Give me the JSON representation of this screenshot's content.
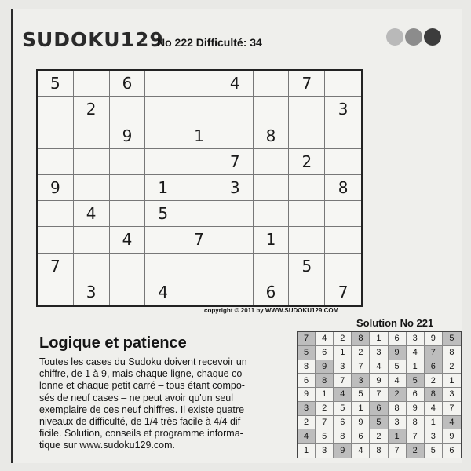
{
  "header": {
    "logo": "SUDOKU129",
    "puzzle_number": "No 222 Difficulté: 34"
  },
  "puzzle": [
    [
      "5",
      "",
      "6",
      "",
      "",
      "4",
      "",
      "7",
      ""
    ],
    [
      "",
      "2",
      "",
      "",
      "",
      "",
      "",
      "",
      "3"
    ],
    [
      "",
      "",
      "9",
      "",
      "1",
      "",
      "8",
      "",
      ""
    ],
    [
      "",
      "",
      "",
      "",
      "",
      "7",
      "",
      "2",
      ""
    ],
    [
      "9",
      "",
      "",
      "1",
      "",
      "3",
      "",
      "",
      "8"
    ],
    [
      "",
      "4",
      "",
      "5",
      "",
      "",
      "",
      "",
      ""
    ],
    [
      "",
      "",
      "4",
      "",
      "7",
      "",
      "1",
      "",
      ""
    ],
    [
      "7",
      "",
      "",
      "",
      "",
      "",
      "",
      "5",
      ""
    ],
    [
      "",
      "3",
      "",
      "4",
      "",
      "",
      "6",
      "",
      "7"
    ]
  ],
  "copyright": "copyright © 2011 by WWW.SUDOKU129.COM",
  "solution": {
    "title": "Solution No 221",
    "grid": [
      [
        "7",
        "4",
        "2",
        "8",
        "1",
        "6",
        "3",
        "9",
        "5"
      ],
      [
        "5",
        "6",
        "1",
        "2",
        "3",
        "9",
        "4",
        "7",
        "8"
      ],
      [
        "8",
        "9",
        "3",
        "7",
        "4",
        "5",
        "1",
        "6",
        "2"
      ],
      [
        "6",
        "8",
        "7",
        "3",
        "9",
        "4",
        "5",
        "2",
        "1"
      ],
      [
        "9",
        "1",
        "4",
        "5",
        "7",
        "2",
        "6",
        "8",
        "3"
      ],
      [
        "3",
        "2",
        "5",
        "1",
        "6",
        "8",
        "9",
        "4",
        "7"
      ],
      [
        "2",
        "7",
        "6",
        "9",
        "5",
        "3",
        "8",
        "1",
        "4"
      ],
      [
        "4",
        "5",
        "8",
        "6",
        "2",
        "1",
        "7",
        "3",
        "9"
      ],
      [
        "1",
        "3",
        "9",
        "4",
        "8",
        "7",
        "2",
        "5",
        "6"
      ]
    ],
    "shaded": [
      [
        0,
        0
      ],
      [
        0,
        3
      ],
      [
        0,
        8
      ],
      [
        1,
        0
      ],
      [
        1,
        5
      ],
      [
        1,
        7
      ],
      [
        2,
        1
      ],
      [
        2,
        7
      ],
      [
        3,
        1
      ],
      [
        3,
        3
      ],
      [
        3,
        6
      ],
      [
        4,
        2
      ],
      [
        4,
        5
      ],
      [
        4,
        7
      ],
      [
        5,
        0
      ],
      [
        5,
        4
      ],
      [
        6,
        4
      ],
      [
        6,
        8
      ],
      [
        7,
        0
      ],
      [
        7,
        5
      ],
      [
        8,
        2
      ],
      [
        8,
        6
      ]
    ]
  },
  "article": {
    "title": "Logique et patience",
    "lines": [
      "Toutes les cases du Sudoku doivent recevoir un",
      "chiffre, de 1 à 9, mais chaque ligne, chaque co-",
      "lonne et chaque petit carré – tous étant compo-",
      "sés de neuf cases – ne peut avoir qu'un seul",
      "exemplaire de ces neuf chiffres. Il existe quatre",
      "niveaux de difficulté, de 1/4 très facile à 4/4 dif-",
      "ficile. Solution, conseils et programme informa-",
      "tique sur www.sudoku129.com."
    ]
  }
}
